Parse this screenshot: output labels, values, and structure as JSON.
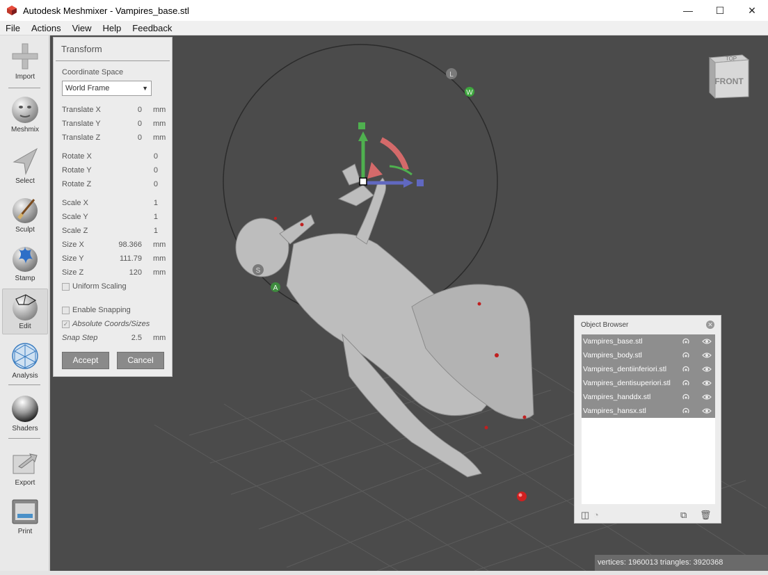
{
  "window": {
    "title": "Autodesk Meshmixer - Vampires_base.stl",
    "minimize": "—",
    "maximize": "☐",
    "close": "✕"
  },
  "menu": [
    "File",
    "Actions",
    "View",
    "Help",
    "Feedback"
  ],
  "tools": [
    "Import",
    "Meshmix",
    "Select",
    "Sculpt",
    "Stamp",
    "Edit",
    "Analysis",
    "Shaders",
    "Export",
    "Print"
  ],
  "active_tool": "Edit",
  "transform": {
    "title": "Transform",
    "coordinate_space_label": "Coordinate Space",
    "coordinate_space_value": "World Frame",
    "fields": [
      {
        "label": "Translate X",
        "value": "0",
        "unit": "mm"
      },
      {
        "label": "Translate Y",
        "value": "0",
        "unit": "mm"
      },
      {
        "label": "Translate Z",
        "value": "0",
        "unit": "mm"
      },
      {
        "label": "Rotate X",
        "value": "0",
        "unit": ""
      },
      {
        "label": "Rotate Y",
        "value": "0",
        "unit": ""
      },
      {
        "label": "Rotate Z",
        "value": "0",
        "unit": ""
      },
      {
        "label": "Scale X",
        "value": "1",
        "unit": ""
      },
      {
        "label": "Scale Y",
        "value": "1",
        "unit": ""
      },
      {
        "label": "Scale Z",
        "value": "1",
        "unit": ""
      },
      {
        "label": "Size X",
        "value": "98.366",
        "unit": "mm"
      },
      {
        "label": "Size Y",
        "value": "111.79",
        "unit": "mm"
      },
      {
        "label": "Size Z",
        "value": "120",
        "unit": "mm"
      }
    ],
    "uniform_scaling": "Uniform Scaling",
    "enable_snapping": "Enable Snapping",
    "absolute_coords": "Absolute Coords/Sizes",
    "snap_step_label": "Snap Step",
    "snap_step_value": "2.5",
    "snap_step_unit": "mm",
    "accept": "Accept",
    "cancel": "Cancel"
  },
  "object_browser": {
    "title": "Object Browser",
    "objects": [
      "Vampires_base.stl",
      "Vampires_body.stl",
      "Vampires_dentiinferiori.stl",
      "Vampires_dentisuperiori.stl",
      "Vampires_handdx.stl",
      "Vampires_hansx.stl"
    ]
  },
  "viewcube": {
    "top": "TOP",
    "front": "FRONT"
  },
  "gizmo_labels": {
    "l": "L",
    "w": "W",
    "s": "S",
    "a": "A"
  },
  "status": "vertices: 1960013 triangles: 3920368"
}
